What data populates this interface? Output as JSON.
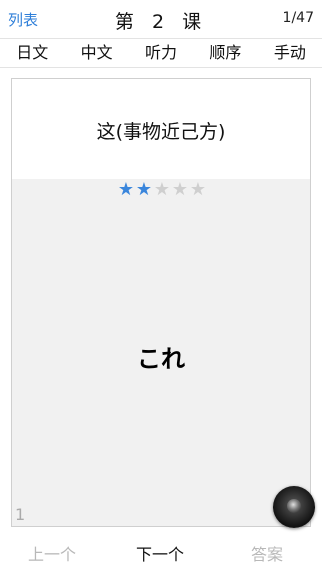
{
  "header": {
    "back_label": "列表",
    "title": "第 2 课",
    "counter": "1/47"
  },
  "tabs": [
    {
      "label": "日文"
    },
    {
      "label": "中文"
    },
    {
      "label": "听力"
    },
    {
      "label": "顺序"
    },
    {
      "label": "手动"
    }
  ],
  "card": {
    "meaning": "这(事物近己方)",
    "rating": 2,
    "rating_max": 5,
    "word": "これ",
    "index": "1"
  },
  "speaker_icon": "speaker-icon",
  "bottom": {
    "prev_label": "上一个",
    "next_label": "下一个",
    "answer_label": "答案"
  },
  "colors": {
    "accent": "#2f7fd9",
    "star_on": "#3a86dc",
    "star_off": "#cfcfcf",
    "disabled_text": "#b8b8b8"
  }
}
